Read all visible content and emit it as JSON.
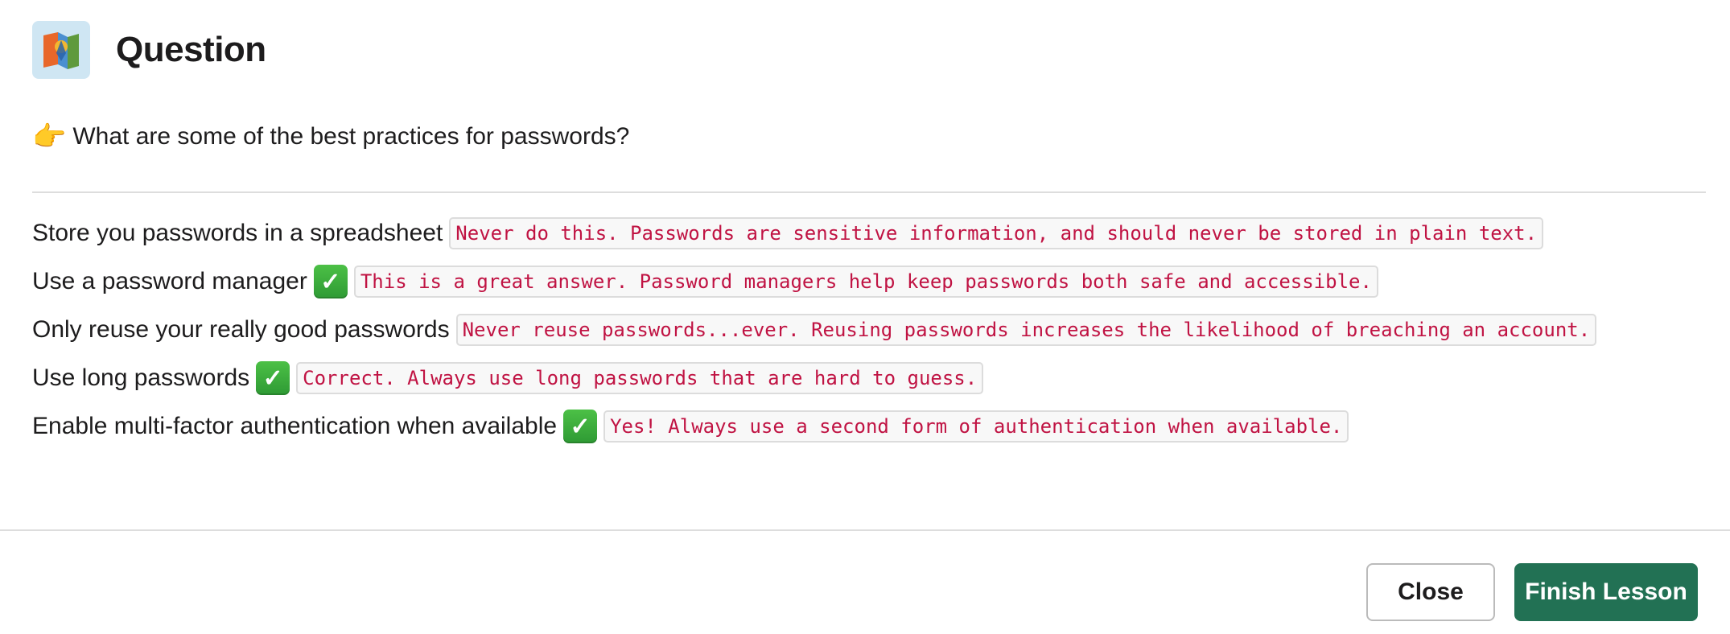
{
  "header": {
    "title": "Question",
    "icon": "lesson-app-icon"
  },
  "question": {
    "emoji": "👉",
    "text": "What are some of the best practices for passwords?"
  },
  "answers": [
    {
      "text": "Store you passwords in a spreadsheet",
      "correct": false,
      "feedback": "Never do this. Passwords are sensitive information, and should never be stored in plain text."
    },
    {
      "text": "Use a password manager",
      "correct": true,
      "check": "✓",
      "feedback": "This is a great answer. Password managers help keep passwords both safe and accessible."
    },
    {
      "text": "Only reuse your really good passwords",
      "correct": false,
      "feedback": "Never reuse passwords...ever. Reusing passwords increases the likelihood of breaching an account."
    },
    {
      "text": "Use long passwords",
      "correct": true,
      "check": "✓",
      "feedback": "Correct. Always use long passwords that are hard to guess."
    },
    {
      "text": "Enable multi-factor authentication when available",
      "correct": true,
      "check": "✓",
      "feedback": "Yes! Always use a second form of authentication when available."
    }
  ],
  "footer": {
    "close_label": "Close",
    "finish_label": "Finish Lesson"
  },
  "colors": {
    "feedback_text": "#c01343",
    "check_green": "#2e9a34",
    "primary_button": "#227154"
  }
}
